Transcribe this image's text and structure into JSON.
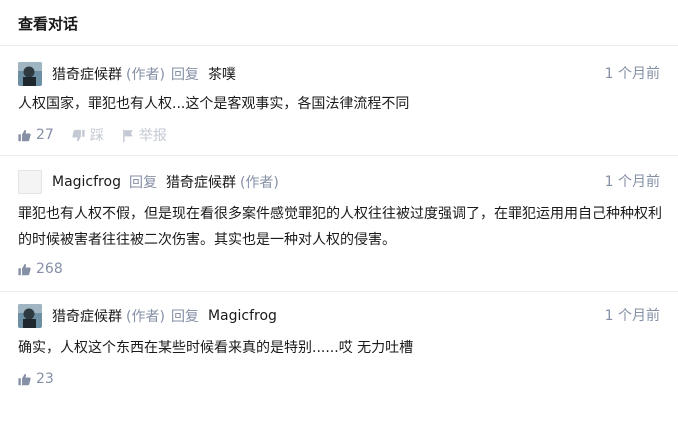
{
  "header": {
    "title": "查看对话"
  },
  "comments": [
    {
      "author": "猎奇症候群",
      "author_tag": "(作者)",
      "reply_label": "回复",
      "reply_to": "茶噗",
      "time": "1 个月前",
      "content": "人权国家，罪犯也有人权...这个是客观事实，各国法律流程不同",
      "likes": "27",
      "dislike_label": "踩",
      "report_label": "举报"
    },
    {
      "author": "Magicfrog",
      "reply_label": "回复",
      "reply_to": "猎奇症候群",
      "reply_to_tag": "(作者)",
      "time": "1 个月前",
      "content": "罪犯也有人权不假，但是现在看很多案件感觉罪犯的人权往往被过度强调了，在罪犯运用用自己种种权利的时候被害者往往被二次伤害。其实也是一种对人权的侵害。",
      "likes": "268"
    },
    {
      "author": "猎奇症候群",
      "author_tag": "(作者)",
      "reply_label": "回复",
      "reply_to": "Magicfrog",
      "time": "1 个月前",
      "content": "确实，人权这个东西在某些时候看来真的是特别......哎 无力吐槽",
      "likes": "23"
    }
  ],
  "icons": {
    "like": "thumbs-up-icon",
    "dislike": "thumbs-down-icon",
    "report": "flag-icon"
  },
  "colors": {
    "text": "#1a1a1a",
    "meta": "#8590a6",
    "divider": "#ebebeb",
    "disabled": "#c4c9d3"
  }
}
